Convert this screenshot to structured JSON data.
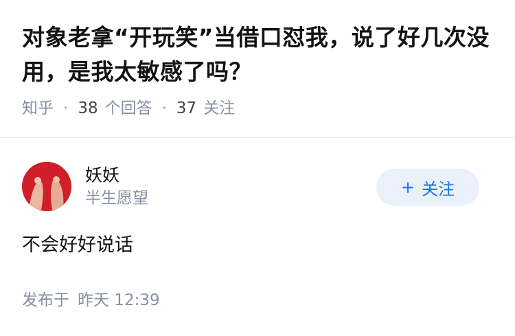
{
  "question": {
    "title": "对象老拿“开玩笑”当借口怼我，说了好几次没用，是我太敏感了吗？",
    "source": "知乎",
    "answers_count": "38",
    "answers_label": "个回答",
    "followers_count": "37",
    "followers_label": "关注"
  },
  "answer": {
    "author_name": "妖妖",
    "author_bio": "半生愿望",
    "follow_label": "关注",
    "follow_icon": "plus-icon",
    "content": "不会好好说话",
    "published_label": "发布于",
    "published_time": "昨天 12:39"
  },
  "colors": {
    "title": "#121212",
    "meta": "#8590a6",
    "accent": "#1772f6",
    "follow_bg": "#eaf1fb"
  }
}
